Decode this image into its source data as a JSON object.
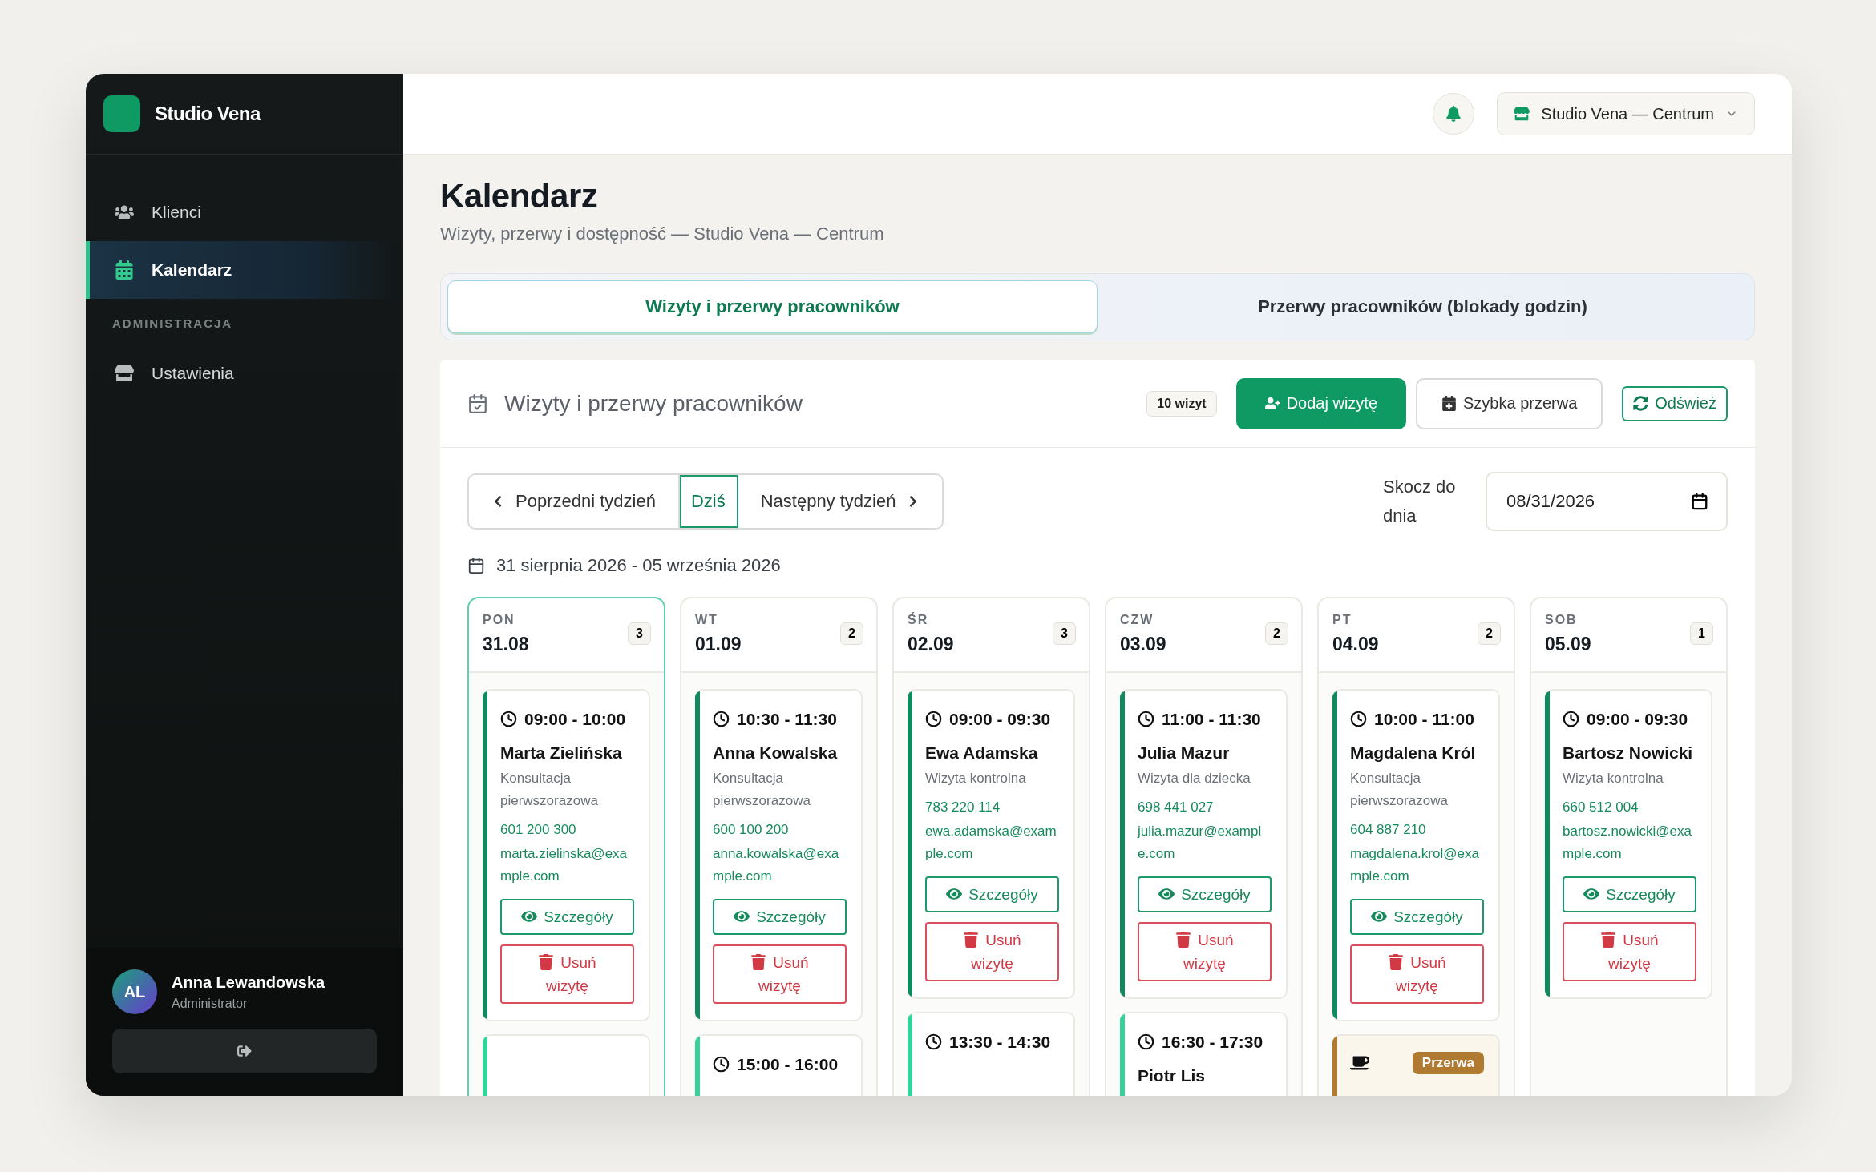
{
  "sidebar": {
    "brand": "Studio Vena",
    "items": [
      {
        "label": "Klienci",
        "selected": false
      },
      {
        "label": "Kalendarz",
        "selected": true
      }
    ],
    "section": "ADMINISTRACJA",
    "admin_items": [
      {
        "label": "Ustawienia",
        "selected": false
      }
    ],
    "user": {
      "initials": "AL",
      "name": "Anna Lewandowska",
      "role": "Administrator"
    }
  },
  "topbar": {
    "location": "Studio Vena — Centrum"
  },
  "page": {
    "title": "Kalendarz",
    "subtitle": "Wizyty, przerwy i dostępność — Studio Vena — Centrum"
  },
  "tabs": [
    {
      "label": "Wizyty i przerwy pracowników",
      "selected": true
    },
    {
      "label": "Przerwy pracowników (blokady godzin)",
      "selected": false
    }
  ],
  "panel": {
    "title": "Wizyty i przerwy pracowników",
    "count": "10 wizyt",
    "buttons": [
      {
        "label": "Dodaj wizytę",
        "kind": "primary"
      },
      {
        "label": "Szybka przerwa",
        "kind": "secondary"
      },
      {
        "label": "Odśwież",
        "kind": "refresh"
      }
    ]
  },
  "navigation": {
    "buttons": [
      {
        "label": "Poprzedni tydzień",
        "kind": "prev",
        "selected": false
      },
      {
        "label": "Dziś",
        "kind": "today",
        "selected": true
      },
      {
        "label": "Następny tydzień",
        "kind": "next",
        "selected": false
      }
    ],
    "jump_label": "Skocz do dnia",
    "date": "08/31/2026"
  },
  "range": "31 sierpnia 2026 - 05 września 2026",
  "days": [
    {
      "weekday": "PON",
      "date": "31.08",
      "count": "3",
      "selected": true,
      "events": [
        {
          "kind": "visit",
          "color": "#0f8a5f",
          "time": "09:00 - 10:00",
          "client": "Marta Zielińska",
          "service": "Konsultacja pierwszorazowa",
          "phone": "601 200 300",
          "email": "marta.zielinska@example.com",
          "details": "Szczegóły",
          "delete": "Usuń wizytę"
        },
        {
          "kind": "visit",
          "color": "#34d399"
        }
      ]
    },
    {
      "weekday": "WT",
      "date": "01.09",
      "count": "2",
      "selected": false,
      "events": [
        {
          "kind": "visit",
          "color": "#0f8a5f",
          "time": "10:30 - 11:30",
          "client": "Anna Kowalska",
          "service": "Konsultacja pierwszorazowa",
          "phone": "600 100 200",
          "email": "anna.kowalska@example.com",
          "details": "Szczegóły",
          "delete": "Usuń wizytę"
        },
        {
          "kind": "visit",
          "color": "#34d399",
          "time": "15:00 - 16:00"
        }
      ]
    },
    {
      "weekday": "ŚR",
      "date": "02.09",
      "count": "3",
      "selected": false,
      "events": [
        {
          "kind": "visit",
          "color": "#0f8a5f",
          "time": "09:00 - 09:30",
          "client": "Ewa Adamska",
          "service": "Wizyta kontrolna",
          "phone": "783 220 114",
          "email": "ewa.adamska@example.com",
          "details": "Szczegóły",
          "delete": "Usuń wizytę"
        },
        {
          "kind": "visit",
          "color": "#34d399",
          "time": "13:30 - 14:30"
        }
      ]
    },
    {
      "weekday": "CZW",
      "date": "03.09",
      "count": "2",
      "selected": false,
      "events": [
        {
          "kind": "visit",
          "color": "#0f8a5f",
          "time": "11:00 - 11:30",
          "client": "Julia Mazur",
          "service": "Wizyta dla dziecka",
          "phone": "698 441 027",
          "email": "julia.mazur@example.com",
          "details": "Szczegóły",
          "delete": "Usuń wizytę"
        },
        {
          "kind": "visit",
          "color": "#34d399",
          "time": "16:30 - 17:30",
          "client": "Piotr Lis"
        }
      ]
    },
    {
      "weekday": "PT",
      "date": "04.09",
      "count": "2",
      "selected": false,
      "events": [
        {
          "kind": "visit",
          "color": "#0f8a5f",
          "time": "10:00 - 11:00",
          "client": "Magdalena Król",
          "service": "Konsultacja pierwszorazowa",
          "phone": "604 887 210",
          "email": "magdalena.krol@example.com",
          "details": "Szczegóły",
          "delete": "Usuń wizytę"
        },
        {
          "kind": "break",
          "color": "#b07a30",
          "badge": "Przerwa"
        }
      ]
    },
    {
      "weekday": "SOB",
      "date": "05.09",
      "count": "1",
      "selected": false,
      "events": [
        {
          "kind": "visit",
          "color": "#0f8a5f",
          "time": "09:00 - 09:30",
          "client": "Bartosz Nowicki",
          "service": "Wizyta kontrolna",
          "phone": "660 512 004",
          "email": "bartosz.nowicki@example.com",
          "details": "Szczegóły",
          "delete": "Usuń wizytę"
        }
      ]
    }
  ]
}
